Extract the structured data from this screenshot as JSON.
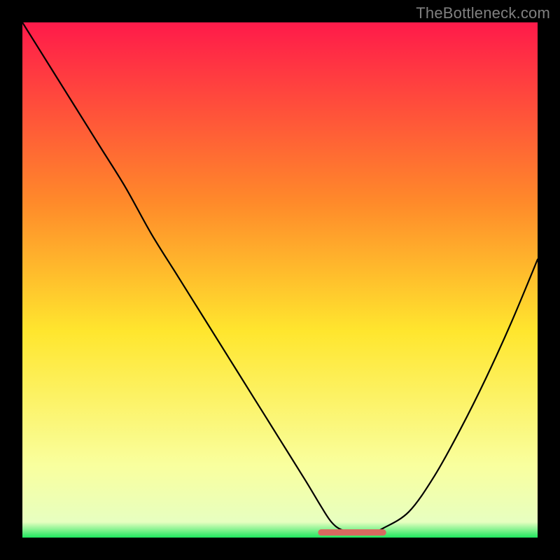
{
  "watermark": "TheBottleneck.com",
  "colors": {
    "bg": "#000000",
    "grad_top": "#ff1a4a",
    "grad_mid1": "#ff8a2a",
    "grad_mid2": "#ffe62e",
    "grad_low": "#f9ff9e",
    "grad_bottom": "#1ee65e",
    "curve": "#000000",
    "flat_segment": "#d86a60"
  },
  "chart_data": {
    "type": "line",
    "title": "",
    "xlabel": "",
    "ylabel": "",
    "xlim": [
      0,
      100
    ],
    "ylim": [
      0,
      100
    ],
    "x": [
      0,
      5,
      10,
      15,
      20,
      25,
      30,
      35,
      40,
      45,
      50,
      55,
      58,
      60,
      62,
      65,
      68,
      70,
      75,
      80,
      85,
      90,
      95,
      100
    ],
    "values": [
      100,
      92,
      84,
      76,
      68,
      59,
      51,
      43,
      35,
      27,
      19,
      11,
      6,
      3,
      1.5,
      1,
      1,
      1.8,
      5,
      12,
      21,
      31,
      42,
      54
    ],
    "series": [
      {
        "name": "bottleneck-curve",
        "x": [
          0,
          5,
          10,
          15,
          20,
          25,
          30,
          35,
          40,
          45,
          50,
          55,
          58,
          60,
          62,
          65,
          68,
          70,
          75,
          80,
          85,
          90,
          95,
          100
        ],
        "values": [
          100,
          92,
          84,
          76,
          68,
          59,
          51,
          43,
          35,
          27,
          19,
          11,
          6,
          3,
          1.5,
          1,
          1,
          1.8,
          5,
          12,
          21,
          31,
          42,
          54
        ]
      }
    ],
    "flat_segment": {
      "x_start": 58,
      "x_end": 70,
      "y": 1
    }
  }
}
